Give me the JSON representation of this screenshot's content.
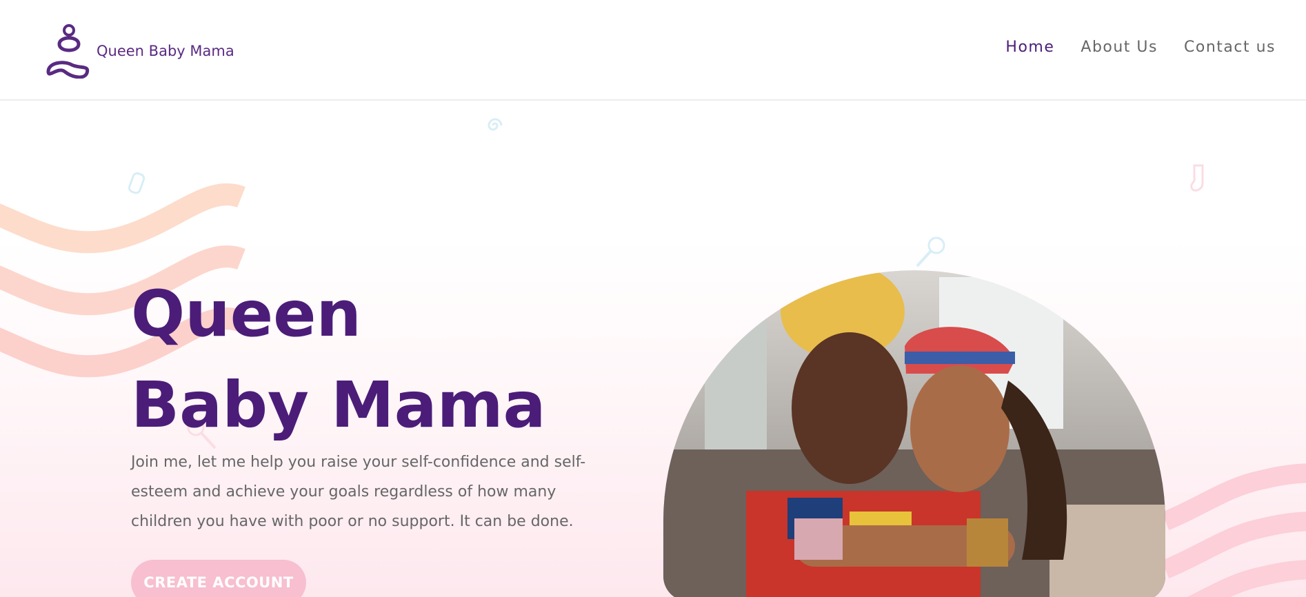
{
  "brand": {
    "name": "Queen Baby Mama",
    "logo_icon": "meditating-figure-icon"
  },
  "nav": {
    "items": [
      {
        "label": "Home",
        "active": true
      },
      {
        "label": "About Us",
        "active": false
      },
      {
        "label": "Contact us",
        "active": false
      }
    ]
  },
  "hero": {
    "title": "Queen Baby Mama",
    "description": "Join me, let me help you raise your self-confidence and self-esteem and achieve your goals regardless of how many children you have with poor or no support. It can be done.",
    "cta_label": "CREATE ACCOUNT",
    "image_icon": "mother-and-daughter-photo"
  },
  "colors": {
    "brand_purple": "#4b1d78",
    "nav_gray": "#666666",
    "cta_pink": "#f7bfd0",
    "wave_peach": "#fddccb",
    "wave_pink": "#fccfd9"
  }
}
